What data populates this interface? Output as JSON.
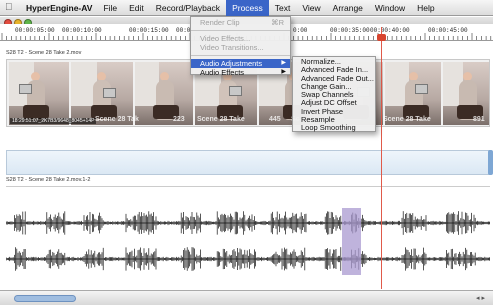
{
  "menubar": {
    "app": "HyperEngine-AV",
    "items": [
      "File",
      "Edit",
      "Record/Playback",
      "Process",
      "Text",
      "View",
      "Arrange",
      "Window",
      "Help"
    ],
    "active": "Process"
  },
  "ruler": {
    "ticks": [
      "00:00:05:00",
      "00:00:10:00",
      "00:00:15:00",
      "00:0",
      "0:00",
      "00:00:35:00",
      "00:00:40:00",
      "00:00:45:00"
    ]
  },
  "video_track": {
    "label": "S28 T2 - Scene 28 Take 2.mov",
    "timecode": "18:29:51:07_2K7B3/9648_8045+14P",
    "overlays": [
      "Scene 28 Tak",
      "223",
      "Scene 28 Take",
      "445",
      "Sc",
      "Scene 28 Take",
      "891"
    ]
  },
  "audio_track": {
    "label": "S28 T2 - Scene 28 Take 2.mov.1-2"
  },
  "process_menu": {
    "items": [
      {
        "label": "Render Clip",
        "shortcut": "⌘R",
        "disabled": true
      },
      {
        "label": "Video Effects...",
        "disabled": true
      },
      {
        "label": "Video Transitions...",
        "disabled": true
      },
      {
        "label": "Audio Adjustments",
        "submenu": true,
        "highlighted": true
      },
      {
        "label": "Audio Effects",
        "submenu": true
      }
    ]
  },
  "audio_adjustments_submenu": {
    "items": [
      "Normalize...",
      "Advanced Fade In...",
      "Advanced Fade Out...",
      "Change Gain...",
      "Swap Channels",
      "Adjust DC Offset",
      "Invert Phase",
      "Resample",
      "Loop Smoothing"
    ]
  },
  "colors": {
    "menu_highlight": "#3a65c8",
    "playhead": "#e05a4a",
    "audio_selection": "#a99ad0"
  }
}
